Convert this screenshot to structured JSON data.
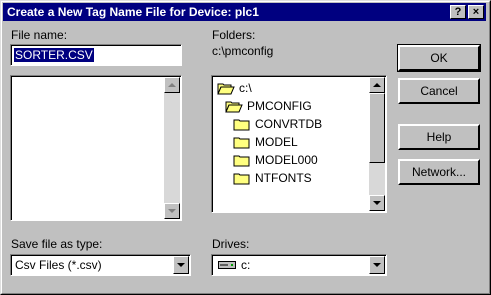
{
  "window": {
    "title": "Create a New Tag Name File for Device: plc1",
    "help_glyph": "?",
    "close_glyph": "×"
  },
  "file_name": {
    "label": "File name:",
    "value": "SORTER.CSV"
  },
  "folders": {
    "label": "Folders:",
    "path": "c:\\pmconfig",
    "items": [
      {
        "name": "c:\\",
        "icon": "open-folder-icon"
      },
      {
        "name": "PMCONFIG",
        "icon": "open-folder-icon"
      },
      {
        "name": "CONVRTDB",
        "icon": "folder-icon"
      },
      {
        "name": "MODEL",
        "icon": "folder-icon"
      },
      {
        "name": "MODEL000",
        "icon": "folder-icon"
      },
      {
        "name": "NTFONTS",
        "icon": "folder-icon"
      }
    ]
  },
  "save_type": {
    "label": "Save file as type:",
    "value": "Csv Files (*.csv)"
  },
  "drives": {
    "label": "Drives:",
    "value": "c:"
  },
  "buttons": {
    "ok": "OK",
    "cancel": "Cancel",
    "help": "Help",
    "network": "Network..."
  },
  "colors": {
    "titlebar": "#000080",
    "face": "#c0c0c0",
    "selection": "#000080"
  }
}
